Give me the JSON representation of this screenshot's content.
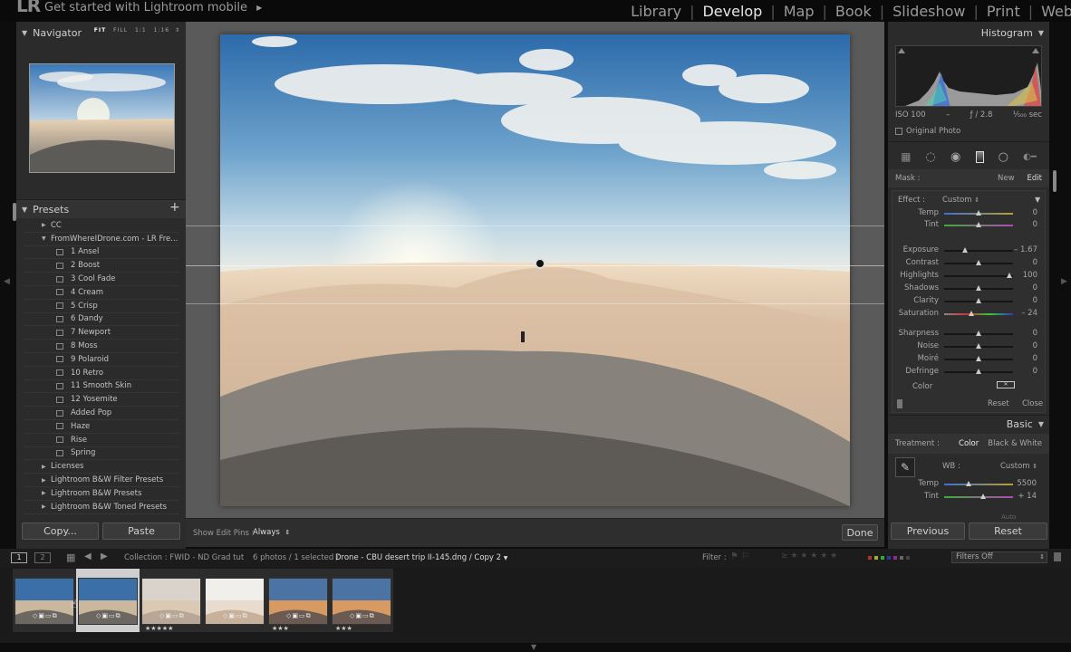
{
  "topbar": {
    "logo": "LR",
    "promo": "Get started with Lightroom mobile",
    "promo_arrow": "▶",
    "modules": [
      "Library",
      "Develop",
      "Map",
      "Book",
      "Slideshow",
      "Print",
      "Web"
    ],
    "active_module": "Develop"
  },
  "navigator": {
    "title": "Navigator",
    "options": [
      "FIT",
      "FILL",
      "1:1",
      "1:16"
    ]
  },
  "presets": {
    "title": "Presets",
    "add_label": "+",
    "items": [
      {
        "label": "CC",
        "type": "folder-closed",
        "indent": 0
      },
      {
        "label": "FromWhereIDrone.com - LR Fre...",
        "type": "folder-open",
        "indent": 0
      },
      {
        "label": "1 Ansel",
        "type": "preset",
        "indent": 1
      },
      {
        "label": "2 Boost",
        "type": "preset",
        "indent": 1
      },
      {
        "label": "3 Cool Fade",
        "type": "preset",
        "indent": 1
      },
      {
        "label": "4 Cream",
        "type": "preset",
        "indent": 1
      },
      {
        "label": "5 Crisp",
        "type": "preset",
        "indent": 1
      },
      {
        "label": "6 Dandy",
        "type": "preset",
        "indent": 1
      },
      {
        "label": "7 Newport",
        "type": "preset",
        "indent": 1
      },
      {
        "label": "8 Moss",
        "type": "preset",
        "indent": 1
      },
      {
        "label": "9 Polaroid",
        "type": "preset",
        "indent": 1
      },
      {
        "label": "10 Retro",
        "type": "preset",
        "indent": 1
      },
      {
        "label": "11 Smooth Skin",
        "type": "preset",
        "indent": 1
      },
      {
        "label": "12 Yosemite",
        "type": "preset",
        "indent": 1
      },
      {
        "label": "Added Pop",
        "type": "preset",
        "indent": 1
      },
      {
        "label": "Haze",
        "type": "preset",
        "indent": 1
      },
      {
        "label": "Rise",
        "type": "preset",
        "indent": 1
      },
      {
        "label": "Spring",
        "type": "preset",
        "indent": 1
      },
      {
        "label": "Licenses",
        "type": "folder-closed",
        "indent": 0
      },
      {
        "label": "Lightroom B&W Filter Presets",
        "type": "folder-closed",
        "indent": 0
      },
      {
        "label": "Lightroom B&W Presets",
        "type": "folder-closed",
        "indent": 0
      },
      {
        "label": "Lightroom B&W Toned Presets",
        "type": "folder-closed",
        "indent": 0
      }
    ]
  },
  "left_buttons": {
    "copy": "Copy...",
    "paste": "Paste"
  },
  "toolbar": {
    "show_pins_label": "Show Edit Pins :",
    "show_pins_value": "Always",
    "done": "Done"
  },
  "histogram": {
    "title": "Histogram",
    "iso": "ISO 100",
    "dash": "–",
    "aperture": "ƒ / 2.8",
    "shutter": "¹⁄₅₀₀ sec",
    "original_photo": "Original Photo"
  },
  "mask": {
    "label": "Mask :",
    "new": "New",
    "edit": "Edit",
    "effect_label": "Effect :",
    "effect_value": "Custom",
    "sliders": [
      {
        "label": "Temp",
        "value": "0",
        "pos": 0.5,
        "track": "temp"
      },
      {
        "label": "Tint",
        "value": "0",
        "pos": 0.5,
        "track": "tint"
      },
      {
        "label": "Exposure",
        "value": "– 1.67",
        "pos": 0.3,
        "track": "gray"
      },
      {
        "label": "Contrast",
        "value": "0",
        "pos": 0.5,
        "track": "gray"
      },
      {
        "label": "Highlights",
        "value": "100",
        "pos": 0.95,
        "track": "gray"
      },
      {
        "label": "Shadows",
        "value": "0",
        "pos": 0.5,
        "track": "gray"
      },
      {
        "label": "Clarity",
        "value": "0",
        "pos": 0.5,
        "track": "gray"
      },
      {
        "label": "Saturation",
        "value": "– 24",
        "pos": 0.4,
        "track": "sat"
      },
      {
        "label": "Sharpness",
        "value": "0",
        "pos": 0.5,
        "track": "gray"
      },
      {
        "label": "Noise",
        "value": "0",
        "pos": 0.5,
        "track": "gray"
      },
      {
        "label": "Moiré",
        "value": "0",
        "pos": 0.5,
        "track": "gray"
      },
      {
        "label": "Defringe",
        "value": "0",
        "pos": 0.5,
        "track": "gray"
      }
    ],
    "color_label": "Color",
    "reset": "Reset",
    "close": "Close"
  },
  "basic": {
    "title": "Basic",
    "treatment_label": "Treatment :",
    "color": "Color",
    "bw": "Black & White",
    "wb_label": "WB :",
    "wb_value": "Custom",
    "sliders": [
      {
        "label": "Temp",
        "value": "5500",
        "pos": 0.36,
        "track": "temp"
      },
      {
        "label": "Tint",
        "value": "+ 14",
        "pos": 0.56,
        "track": "tint"
      }
    ],
    "auto_hint": "Auto"
  },
  "right_buttons": {
    "previous": "Previous",
    "reset": "Reset"
  },
  "filmbar": {
    "view1": "1",
    "view2": "2",
    "collection": "Collection : FWID - ND Grad tut",
    "photo_count": "6 photos / 1 selected /",
    "filename": "Drone - CBU desert trip II-145.dng / Copy 2",
    "filter_label": "Filter :",
    "filters_off": "Filters Off"
  },
  "filmstrip": [
    {
      "tone": "desert-blue",
      "stars": "",
      "selected": false
    },
    {
      "tone": "desert-blue",
      "stars": "",
      "selected": true
    },
    {
      "tone": "desert-pale",
      "stars": "★★★★★",
      "selected": false
    },
    {
      "tone": "desert-white",
      "stars": "",
      "selected": false
    },
    {
      "tone": "desert-sunset",
      "stars": "★★★",
      "selected": false
    },
    {
      "tone": "desert-sunset",
      "stars": "★★★",
      "selected": false
    }
  ]
}
